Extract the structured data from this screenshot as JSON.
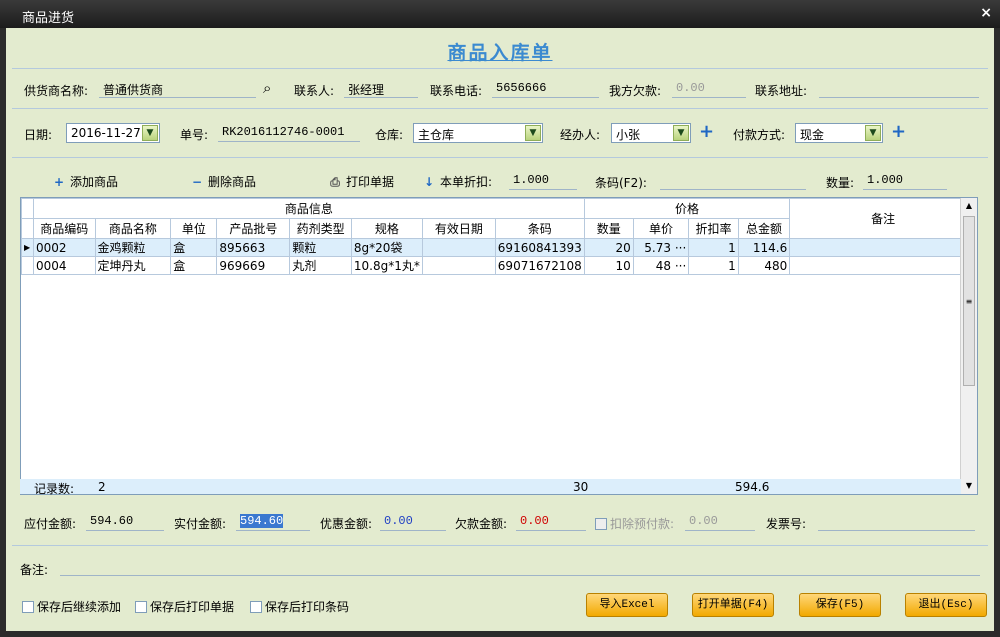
{
  "window": {
    "title": "商品进货",
    "close_glyph": "×"
  },
  "form_title": "商品入库单",
  "supplier": {
    "label": "供货商名称:",
    "value": "普通供货商",
    "icon": "binoculars-icon"
  },
  "contact": {
    "label": "联系人:",
    "value": "张经理"
  },
  "phone": {
    "label": "联系电话:",
    "value": "5656666"
  },
  "debt": {
    "label": "我方欠款:",
    "value": "0.00"
  },
  "address": {
    "label": "联系地址:",
    "value": ""
  },
  "date": {
    "label": "日期:",
    "value": "2016-11-27"
  },
  "order_no": {
    "label": "单号:",
    "value": "RK2016112746-0001"
  },
  "warehouse": {
    "label": "仓库:",
    "value": "主仓库"
  },
  "handler": {
    "label": "经办人:",
    "value": "小张"
  },
  "payment": {
    "label": "付款方式:",
    "value": "现金"
  },
  "toolbar": {
    "add": "添加商品",
    "delete": "删除商品",
    "print": "打印单据",
    "discount_label": "本单折扣:",
    "discount_value": "1.000",
    "barcode_label": "条码(F2):",
    "barcode_value": "",
    "qty_label": "数量:",
    "qty_value": "1.000"
  },
  "grid": {
    "group_product": "商品信息",
    "group_price": "价格",
    "group_note": "备注",
    "columns": [
      "商品编码",
      "商品名称",
      "单位",
      "产品批号",
      "药剂类型",
      "规格",
      "有效日期",
      "条码",
      "数量",
      "单价",
      "折扣率",
      "总金额"
    ],
    "rows": [
      [
        "0002",
        "金鸡颗粒",
        "盒",
        "895663",
        "颗粒",
        "8g*20袋",
        "",
        "69160841393",
        "20",
        "5.73 ···",
        "1",
        "114.6"
      ],
      [
        "0004",
        "定坤丹丸",
        "盒",
        "969669",
        "丸剂",
        "10.8g*1丸*",
        "",
        "69071672108",
        "10",
        "48 ···",
        "1",
        "480"
      ]
    ],
    "footer": {
      "label": "记录数:",
      "count": "2",
      "qty_total": "30",
      "amount_total": "594.6"
    }
  },
  "totals": {
    "payable_label": "应付金额:",
    "payable": "594.60",
    "paid_label": "实付金额:",
    "paid": "594.60",
    "discount_label": "优惠金额:",
    "discount": "0.00",
    "owed_label": "欠款金额:",
    "owed": "0.00",
    "prepaid_label": "扣除预付款:",
    "prepaid": "0.00",
    "invoice_label": "发票号:",
    "invoice": ""
  },
  "remark": {
    "label": "备注:",
    "value": ""
  },
  "options": {
    "continue": "保存后继续添加",
    "print_bill": "保存后打印单据",
    "print_barcode": "保存后打印条码"
  },
  "buttons": {
    "import": "导入Excel",
    "open": "打开单据(F4)",
    "save": "保存(F5)",
    "exit": "退出(Esc)"
  },
  "colors": {
    "panel": "#e3ebcf",
    "accent": "#3b8ad0",
    "button": "#f2a900",
    "owed": "#d00000",
    "discount": "#1f3fc4"
  }
}
